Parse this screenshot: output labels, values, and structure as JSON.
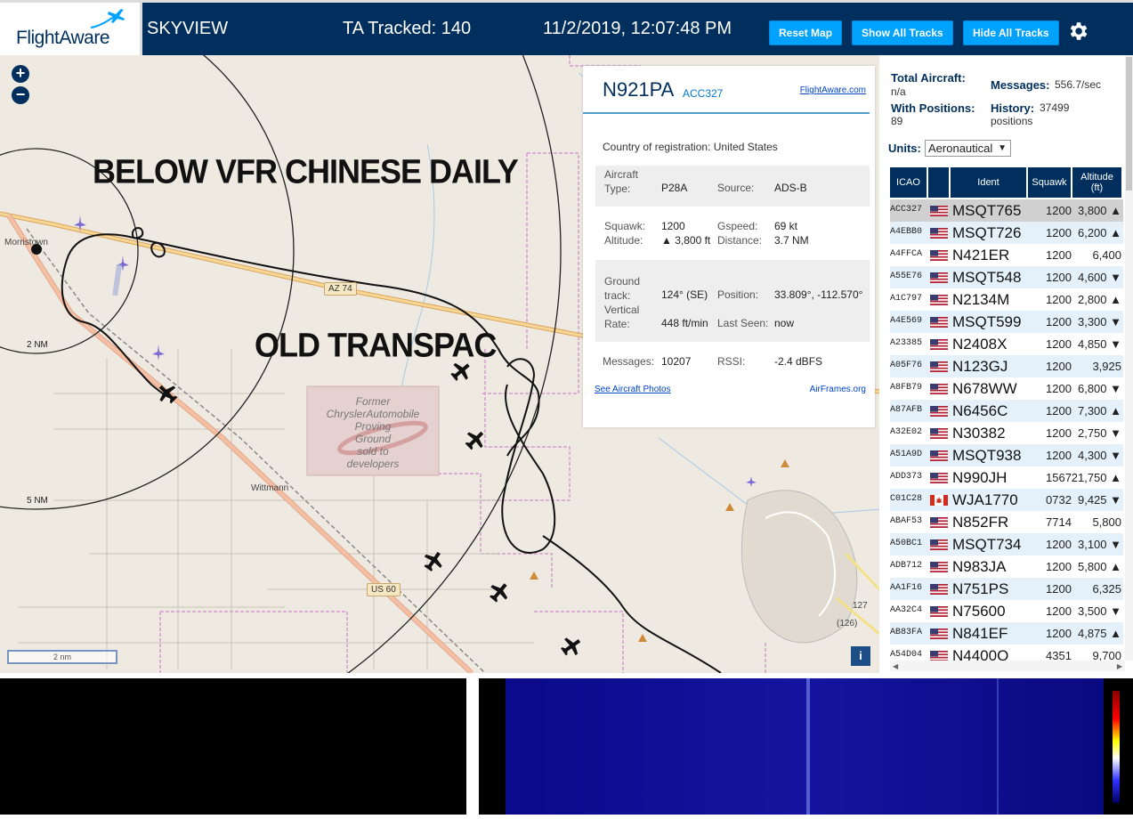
{
  "header": {
    "logo_text": "FlightAware",
    "app_name": "SKYVIEW",
    "tracked": "TA Tracked: 140",
    "datetime": "11/2/2019, 12:07:48 PM",
    "reset_btn": "Reset Map",
    "show_btn": "Show All Tracks",
    "hide_btn": "Hide All Tracks"
  },
  "map": {
    "zoom_in": "+",
    "zoom_out": "−",
    "annotation_top": "BELOW VFR CHINESE DAILY",
    "annotation_mid": "OLD TRANSPAC",
    "town_morristown": "Morristown",
    "town_wittmann": "Wittmann",
    "ring_2nm": "2 NM",
    "ring_5nm": "5 NM",
    "road_az74": "AZ 74",
    "road_us60": "US 60",
    "road_127": "127",
    "road_126": "(126)",
    "poi_lines": [
      "Former",
      "ChryslerAutomobile",
      "Proving",
      "Ground",
      "sold to",
      "developers"
    ],
    "scale": "2 nm",
    "info": "i"
  },
  "popup": {
    "callsign": "N921PA",
    "icao": "ACC327",
    "fa_link": "FlightAware.com",
    "country_label": "Country of registration:",
    "country": "United States",
    "aircraft_type_label": "Aircraft Type:",
    "aircraft_type": "P28A",
    "source_label": "Source:",
    "source": "ADS-B",
    "squawk_label": "Squawk:",
    "squawk": "1200",
    "gspeed_label": "Gspeed:",
    "gspeed": "69 kt",
    "altitude_label": "Altitude:",
    "altitude": "▲ 3,800 ft",
    "distance_label": "Distance:",
    "distance": "3.7 NM",
    "ground_track_label": "Ground track:",
    "ground_track": "124° (SE)",
    "position_label": "Position:",
    "position": "33.809°, -112.570°",
    "vrate_label": "Vertical Rate:",
    "vrate": "448 ft/min",
    "last_seen_label": "Last Seen:",
    "last_seen": "now",
    "messages_label": "Messages:",
    "messages": "10207",
    "rssi_label": "RSSI:",
    "rssi": "-2.4 dBFS",
    "photos_link": "See Aircraft Photos",
    "airframes_link": "AirFrames.org"
  },
  "panel": {
    "total_label": "Total Aircraft:",
    "total_val": "n/a",
    "messages_label": "Messages:",
    "messages_val": "556.7/sec",
    "withpos_label": "With Positions:",
    "withpos_val": "89",
    "history_label": "History:",
    "history_val": "37499",
    "history_unit": "positions",
    "units_label": "Units:",
    "units_val": "Aeronautical",
    "cols": {
      "icao": "ICAO",
      "ident": "Ident",
      "squawk": "Squawk",
      "alt": "Altitude",
      "alt_unit": "(ft)"
    },
    "rows": [
      {
        "icao": "ACC327",
        "flag": "us",
        "ident": "MSQT765",
        "squawk": "1200",
        "alt": "3,800 ▲"
      },
      {
        "icao": "A4EBB0",
        "flag": "us",
        "ident": "MSQT726",
        "squawk": "1200",
        "alt": "6,200 ▲"
      },
      {
        "icao": "A4FFCA",
        "flag": "us",
        "ident": "N421ER",
        "squawk": "1200",
        "alt": "6,400"
      },
      {
        "icao": "A55E76",
        "flag": "us",
        "ident": "MSQT548",
        "squawk": "1200",
        "alt": "4,600 ▼"
      },
      {
        "icao": "A1C797",
        "flag": "us",
        "ident": "N2134M",
        "squawk": "1200",
        "alt": "2,800 ▲"
      },
      {
        "icao": "A4E569",
        "flag": "us",
        "ident": "MSQT599",
        "squawk": "1200",
        "alt": "3,300 ▼"
      },
      {
        "icao": "A23385",
        "flag": "us",
        "ident": "N2408X",
        "squawk": "1200",
        "alt": "4,850 ▼"
      },
      {
        "icao": "A05F76",
        "flag": "us",
        "ident": "N123GJ",
        "squawk": "1200",
        "alt": "3,925"
      },
      {
        "icao": "A8FB79",
        "flag": "us",
        "ident": "N678WW",
        "squawk": "1200",
        "alt": "6,800 ▼"
      },
      {
        "icao": "A87AFB",
        "flag": "us",
        "ident": "N6456C",
        "squawk": "1200",
        "alt": "7,300 ▲"
      },
      {
        "icao": "A32E02",
        "flag": "us",
        "ident": "N30382",
        "squawk": "1200",
        "alt": "2,750 ▼"
      },
      {
        "icao": "A51A9D",
        "flag": "us",
        "ident": "MSQT938",
        "squawk": "1200",
        "alt": "4,300 ▼"
      },
      {
        "icao": "ADD373",
        "flag": "us",
        "ident": "N990JH",
        "squawk": "1567",
        "alt": "21,750 ▲"
      },
      {
        "icao": "C01C28",
        "flag": "ca",
        "ident": "WJA1770",
        "squawk": "0732",
        "alt": "9,425 ▼"
      },
      {
        "icao": "ABAF53",
        "flag": "us",
        "ident": "N852FR",
        "squawk": "7714",
        "alt": "5,800"
      },
      {
        "icao": "A50BC1",
        "flag": "us",
        "ident": "MSQT734",
        "squawk": "1200",
        "alt": "3,100 ▼"
      },
      {
        "icao": "ADB712",
        "flag": "us",
        "ident": "N983JA",
        "squawk": "1200",
        "alt": "5,800 ▲"
      },
      {
        "icao": "AA1F16",
        "flag": "us",
        "ident": "N751PS",
        "squawk": "1200",
        "alt": "6,325"
      },
      {
        "icao": "AA32C4",
        "flag": "us",
        "ident": "N75600",
        "squawk": "1200",
        "alt": "3,500 ▼"
      },
      {
        "icao": "AB83FA",
        "flag": "us",
        "ident": "N841EF",
        "squawk": "1200",
        "alt": "4,875 ▲"
      },
      {
        "icao": "A54D04",
        "flag": "us",
        "ident": "N4400Q",
        "squawk": "4351",
        "alt": "9,700"
      }
    ]
  },
  "colors": {
    "header_bg": "#002f5d",
    "button_bg": "#00a2ff",
    "map_bg": "#efeae1",
    "row_alt": "#e4f1fb",
    "row_selected": "#d0d0d0"
  }
}
